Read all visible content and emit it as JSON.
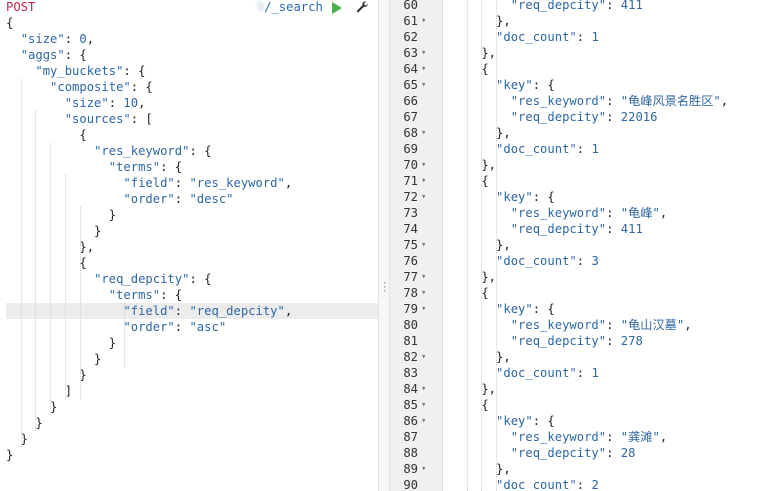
{
  "request": {
    "method": "POST",
    "url_hidden": "                             9",
    "url_path": "/_search"
  },
  "left_lines": [
    [
      [
        "p",
        "{"
      ]
    ],
    [
      [
        "p",
        "  "
      ],
      [
        "k",
        "\"size\""
      ],
      [
        "p",
        ": "
      ],
      [
        "n",
        "0"
      ],
      [
        "p",
        ","
      ]
    ],
    [
      [
        "p",
        "  "
      ],
      [
        "k",
        "\"aggs\""
      ],
      [
        "p",
        ": {"
      ]
    ],
    [
      [
        "p",
        "    "
      ],
      [
        "k",
        "\"my_buckets\""
      ],
      [
        "p",
        ": {"
      ]
    ],
    [
      [
        "p",
        "      "
      ],
      [
        "k",
        "\"composite\""
      ],
      [
        "p",
        ": {"
      ]
    ],
    [
      [
        "p",
        "        "
      ],
      [
        "k",
        "\"size\""
      ],
      [
        "p",
        ": "
      ],
      [
        "n",
        "10"
      ],
      [
        "p",
        ","
      ]
    ],
    [
      [
        "p",
        "        "
      ],
      [
        "k",
        "\"sources\""
      ],
      [
        "p",
        ": ["
      ]
    ],
    [
      [
        "p",
        "          {"
      ]
    ],
    [
      [
        "p",
        "            "
      ],
      [
        "k",
        "\"res_keyword\""
      ],
      [
        "p",
        ": {"
      ]
    ],
    [
      [
        "p",
        "              "
      ],
      [
        "k",
        "\"terms\""
      ],
      [
        "p",
        ": {"
      ]
    ],
    [
      [
        "p",
        "                "
      ],
      [
        "k",
        "\"field\""
      ],
      [
        "p",
        ": "
      ],
      [
        "s",
        "\"res_keyword\""
      ],
      [
        "p",
        ","
      ]
    ],
    [
      [
        "p",
        "                "
      ],
      [
        "k",
        "\"order\""
      ],
      [
        "p",
        ": "
      ],
      [
        "s",
        "\"desc\""
      ]
    ],
    [
      [
        "p",
        "              }"
      ]
    ],
    [
      [
        "p",
        "            }"
      ]
    ],
    [
      [
        "p",
        "          },"
      ]
    ],
    [
      [
        "p",
        "          {"
      ]
    ],
    [
      [
        "p",
        "            "
      ],
      [
        "k",
        "\"req_depcity\""
      ],
      [
        "p",
        ": {"
      ]
    ],
    [
      [
        "p",
        "              "
      ],
      [
        "k",
        "\"terms\""
      ],
      [
        "p",
        ": {"
      ]
    ],
    [
      [
        "p",
        "                "
      ],
      [
        "k",
        "\"field\""
      ],
      [
        "p",
        ": "
      ],
      [
        "s",
        "\"req_depcity\""
      ],
      [
        "p",
        ","
      ]
    ],
    [
      [
        "p",
        "                "
      ],
      [
        "k",
        "\"order\""
      ],
      [
        "p",
        ": "
      ],
      [
        "s",
        "\"asc\""
      ]
    ],
    [
      [
        "p",
        "              }"
      ]
    ],
    [
      [
        "p",
        "            }"
      ]
    ],
    [
      [
        "p",
        "          }"
      ]
    ],
    [
      [
        "p",
        "        ]"
      ]
    ],
    [
      [
        "p",
        "      }"
      ]
    ],
    [
      [
        "p",
        "    }"
      ]
    ],
    [
      [
        "p",
        "  }"
      ]
    ],
    [
      [
        "p",
        "}"
      ]
    ]
  ],
  "right_lines": [
    {
      "n": "60",
      "f": "",
      "t": [
        [
          "p",
          "        "
        ],
        [
          "k",
          "\"req_depcity\""
        ],
        [
          "p",
          ": "
        ],
        [
          "n",
          "411"
        ]
      ]
    },
    {
      "n": "61",
      "f": "▾",
      "t": [
        [
          "p",
          "      },"
        ]
      ]
    },
    {
      "n": "62",
      "f": "",
      "t": [
        [
          "p",
          "      "
        ],
        [
          "k",
          "\"doc_count\""
        ],
        [
          "p",
          ": "
        ],
        [
          "n",
          "1"
        ]
      ]
    },
    {
      "n": "63",
      "f": "▾",
      "t": [
        [
          "p",
          "    },"
        ]
      ]
    },
    {
      "n": "64",
      "f": "▾",
      "t": [
        [
          "p",
          "    {"
        ]
      ]
    },
    {
      "n": "65",
      "f": "▾",
      "t": [
        [
          "p",
          "      "
        ],
        [
          "k",
          "\"key\""
        ],
        [
          "p",
          ": {"
        ]
      ]
    },
    {
      "n": "66",
      "f": "",
      "t": [
        [
          "p",
          "        "
        ],
        [
          "k",
          "\"res_keyword\""
        ],
        [
          "p",
          ": "
        ],
        [
          "s",
          "\"龟峰风景名胜区\""
        ],
        [
          "p",
          ","
        ]
      ]
    },
    {
      "n": "67",
      "f": "",
      "t": [
        [
          "p",
          "        "
        ],
        [
          "k",
          "\"req_depcity\""
        ],
        [
          "p",
          ": "
        ],
        [
          "n",
          "22016"
        ]
      ]
    },
    {
      "n": "68",
      "f": "▾",
      "t": [
        [
          "p",
          "      },"
        ]
      ]
    },
    {
      "n": "69",
      "f": "",
      "t": [
        [
          "p",
          "      "
        ],
        [
          "k",
          "\"doc_count\""
        ],
        [
          "p",
          ": "
        ],
        [
          "n",
          "1"
        ]
      ]
    },
    {
      "n": "70",
      "f": "▾",
      "t": [
        [
          "p",
          "    },"
        ]
      ]
    },
    {
      "n": "71",
      "f": "▾",
      "t": [
        [
          "p",
          "    {"
        ]
      ]
    },
    {
      "n": "72",
      "f": "▾",
      "t": [
        [
          "p",
          "      "
        ],
        [
          "k",
          "\"key\""
        ],
        [
          "p",
          ": {"
        ]
      ]
    },
    {
      "n": "73",
      "f": "",
      "t": [
        [
          "p",
          "        "
        ],
        [
          "k",
          "\"res_keyword\""
        ],
        [
          "p",
          ": "
        ],
        [
          "s",
          "\"龟峰\""
        ],
        [
          "p",
          ","
        ]
      ]
    },
    {
      "n": "74",
      "f": "",
      "t": [
        [
          "p",
          "        "
        ],
        [
          "k",
          "\"req_depcity\""
        ],
        [
          "p",
          ": "
        ],
        [
          "n",
          "411"
        ]
      ]
    },
    {
      "n": "75",
      "f": "▾",
      "t": [
        [
          "p",
          "      },"
        ]
      ]
    },
    {
      "n": "76",
      "f": "",
      "t": [
        [
          "p",
          "      "
        ],
        [
          "k",
          "\"doc_count\""
        ],
        [
          "p",
          ": "
        ],
        [
          "n",
          "3"
        ]
      ]
    },
    {
      "n": "77",
      "f": "▾",
      "t": [
        [
          "p",
          "    },"
        ]
      ]
    },
    {
      "n": "78",
      "f": "▾",
      "t": [
        [
          "p",
          "    {"
        ]
      ]
    },
    {
      "n": "79",
      "f": "▾",
      "t": [
        [
          "p",
          "      "
        ],
        [
          "k",
          "\"key\""
        ],
        [
          "p",
          ": {"
        ]
      ]
    },
    {
      "n": "80",
      "f": "",
      "t": [
        [
          "p",
          "        "
        ],
        [
          "k",
          "\"res_keyword\""
        ],
        [
          "p",
          ": "
        ],
        [
          "s",
          "\"龟山汉墓\""
        ],
        [
          "p",
          ","
        ]
      ]
    },
    {
      "n": "81",
      "f": "",
      "t": [
        [
          "p",
          "        "
        ],
        [
          "k",
          "\"req_depcity\""
        ],
        [
          "p",
          ": "
        ],
        [
          "n",
          "278"
        ]
      ]
    },
    {
      "n": "82",
      "f": "▾",
      "t": [
        [
          "p",
          "      },"
        ]
      ]
    },
    {
      "n": "83",
      "f": "",
      "t": [
        [
          "p",
          "      "
        ],
        [
          "k",
          "\"doc_count\""
        ],
        [
          "p",
          ": "
        ],
        [
          "n",
          "1"
        ]
      ]
    },
    {
      "n": "84",
      "f": "▾",
      "t": [
        [
          "p",
          "    },"
        ]
      ]
    },
    {
      "n": "85",
      "f": "▾",
      "t": [
        [
          "p",
          "    {"
        ]
      ]
    },
    {
      "n": "86",
      "f": "▾",
      "t": [
        [
          "p",
          "      "
        ],
        [
          "k",
          "\"key\""
        ],
        [
          "p",
          ": {"
        ]
      ]
    },
    {
      "n": "87",
      "f": "",
      "t": [
        [
          "p",
          "        "
        ],
        [
          "k",
          "\"res_keyword\""
        ],
        [
          "p",
          ": "
        ],
        [
          "s",
          "\"龚滩\""
        ],
        [
          "p",
          ","
        ]
      ]
    },
    {
      "n": "88",
      "f": "",
      "t": [
        [
          "p",
          "        "
        ],
        [
          "k",
          "\"req_depcity\""
        ],
        [
          "p",
          ": "
        ],
        [
          "n",
          "28"
        ]
      ]
    },
    {
      "n": "89",
      "f": "▾",
      "t": [
        [
          "p",
          "      },"
        ]
      ]
    },
    {
      "n": "90",
      "f": "",
      "t": [
        [
          "p",
          "      "
        ],
        [
          "k",
          "\"doc_count\""
        ],
        [
          "p",
          ": "
        ],
        [
          "n",
          "2"
        ]
      ]
    }
  ],
  "highlight_left_line": 18,
  "colors": {
    "method": "#c7254e",
    "token": "#2f67a3",
    "run": "#4caf50"
  },
  "icons": {
    "run": "play-triangle",
    "settings": "wrench",
    "resize": "vertical-dots"
  }
}
